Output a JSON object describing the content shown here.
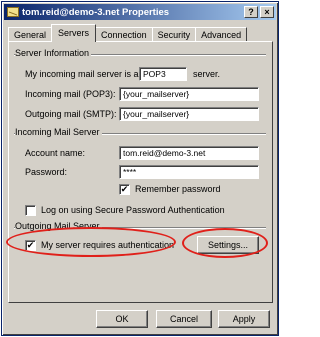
{
  "window": {
    "title": "tom.reid@demo-3.net Properties"
  },
  "tabs": [
    {
      "label": "General",
      "active": false
    },
    {
      "label": "Servers",
      "active": true
    },
    {
      "label": "Connection",
      "active": false
    },
    {
      "label": "Security",
      "active": false
    },
    {
      "label": "Advanced",
      "active": false
    }
  ],
  "server_info": {
    "heading": "Server Information",
    "type_prefix": "My incoming mail server is a",
    "type_value": "POP3",
    "type_suffix": "server.",
    "incoming_label": "Incoming mail (POP3):",
    "incoming_value": "{your_mailserver}",
    "outgoing_label": "Outgoing mail (SMTP):",
    "outgoing_value": "{your_mailserver}"
  },
  "incoming_server": {
    "heading": "Incoming Mail Server",
    "account_label": "Account name:",
    "account_value": "tom.reid@demo-3.net",
    "password_label": "Password:",
    "password_value": "****",
    "remember_label": "Remember password",
    "remember_checked": true,
    "spa_label": "Log on using Secure Password Authentication",
    "spa_checked": false
  },
  "outgoing_server": {
    "heading": "Outgoing Mail Server",
    "auth_label": "My server requires authentication",
    "auth_checked": true,
    "settings_label": "Settings..."
  },
  "footer": {
    "ok_label": "OK",
    "cancel_label": "Cancel",
    "apply_label": "Apply"
  },
  "glyphs": {
    "check": "✔",
    "help": "?",
    "close": "×"
  },
  "colors": {
    "highlight_oval": "#e0201a",
    "titlebar": "#0a246a"
  }
}
